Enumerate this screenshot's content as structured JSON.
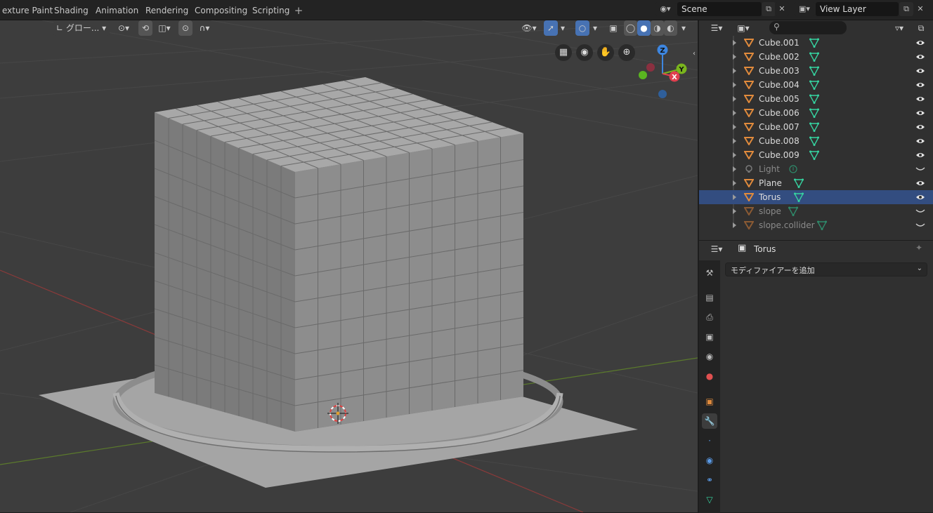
{
  "workspace_tabs": [
    "exture Paint",
    "Shading",
    "Animation",
    "Rendering",
    "Compositing",
    "Scripting"
  ],
  "scene": {
    "name": "Scene"
  },
  "view_layer": {
    "name": "View Layer"
  },
  "viewport": {
    "transform_orientation": "グロー...",
    "gizmo": {
      "z": "Z",
      "y": "Y",
      "x": "X"
    }
  },
  "outliner": {
    "search_placeholder": "",
    "items": [
      {
        "name": "Cube.001",
        "dim": false,
        "selected": false
      },
      {
        "name": "Cube.002",
        "dim": false,
        "selected": false
      },
      {
        "name": "Cube.003",
        "dim": false,
        "selected": false
      },
      {
        "name": "Cube.004",
        "dim": false,
        "selected": false
      },
      {
        "name": "Cube.005",
        "dim": false,
        "selected": false
      },
      {
        "name": "Cube.006",
        "dim": false,
        "selected": false
      },
      {
        "name": "Cube.007",
        "dim": false,
        "selected": false
      },
      {
        "name": "Cube.008",
        "dim": false,
        "selected": false
      },
      {
        "name": "Cube.009",
        "dim": false,
        "selected": false
      },
      {
        "name": "Light",
        "dim": true,
        "selected": false,
        "type": "light"
      },
      {
        "name": "Plane",
        "dim": false,
        "selected": false
      },
      {
        "name": "Torus",
        "dim": false,
        "selected": true
      },
      {
        "name": "slope",
        "dim": true,
        "selected": false
      },
      {
        "name": "slope.collider",
        "dim": true,
        "selected": false
      }
    ]
  },
  "properties": {
    "object_name": "Torus",
    "add_modifier": "モディファイアーを追加"
  },
  "colors": {
    "selection": "#334d80",
    "mesh_green": "#36d3a0",
    "object_orange": "#e08a3c",
    "x_axis": "#e0404f",
    "y_axis": "#7ab51d",
    "z_axis": "#3d86e0"
  }
}
